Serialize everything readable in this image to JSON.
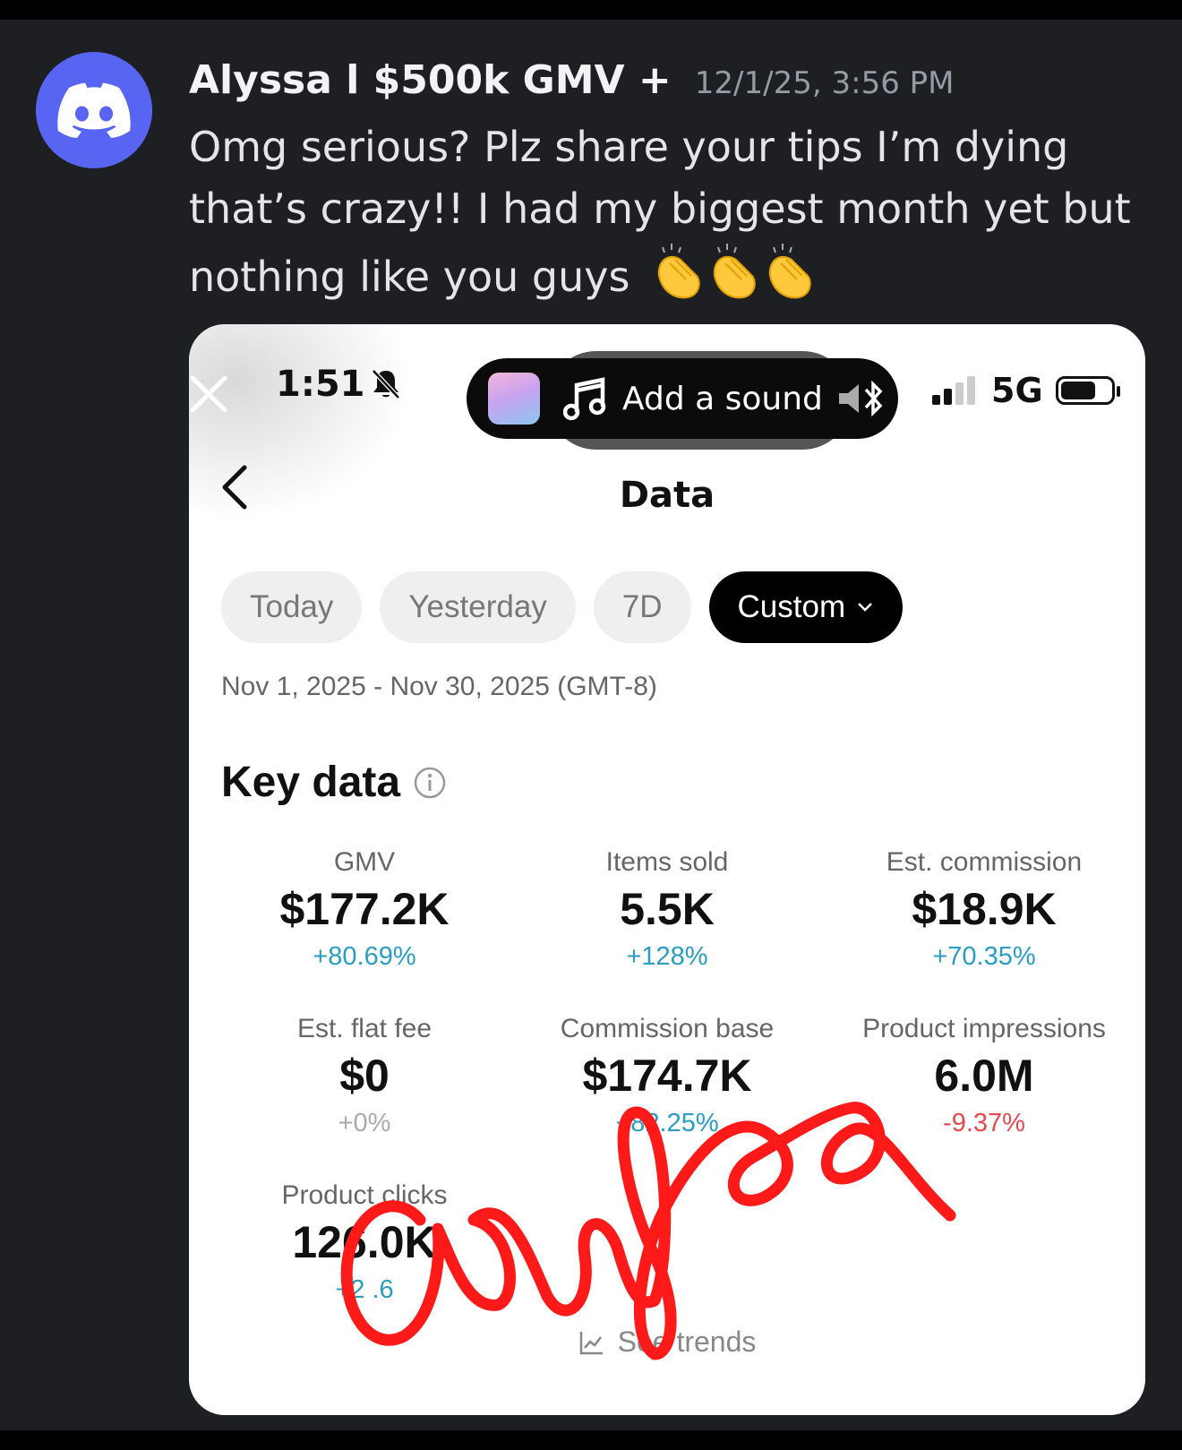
{
  "message": {
    "username": "Alyssa l $500k GMV +",
    "timestamp": "12/1/25, 3:56 PM",
    "text": "Omg serious? Plz share your tips I’m dying that’s crazy!! I had my biggest month yet but nothing like you guys",
    "emoji": "clapping-hands ×3"
  },
  "phone": {
    "status_time": "1:51",
    "network": "5G",
    "island_label": "Add a sound",
    "page_title": "Data",
    "tabs": [
      "Today",
      "Yesterday",
      "7D",
      "Custom"
    ],
    "active_tab": "Custom",
    "date_range": "Nov 1, 2025 - Nov 30, 2025 (GMT-8)",
    "section_title": "Key data",
    "metrics": [
      {
        "label": "GMV",
        "value": "$177.2K",
        "change": "+80.69%"
      },
      {
        "label": "Items sold",
        "value": "5.5K",
        "change": "+128%"
      },
      {
        "label": "Est. commission",
        "value": "$18.9K",
        "change": "+70.35%"
      },
      {
        "label": "Est. flat fee",
        "value": "$0",
        "change": "+0%"
      },
      {
        "label": "Commission base",
        "value": "$174.7K",
        "change": "+82.25%"
      },
      {
        "label": "Product impressions",
        "value": "6.0M",
        "change": "-9.37%"
      },
      {
        "label": "Product clicks",
        "value": "126.0K",
        "change": "+2 .6"
      }
    ],
    "see_trends": "See trends"
  },
  "colors": {
    "background": "#1e1f23",
    "discord_blurple": "#5865f2",
    "positive": "#2a9dc0",
    "negative": "#e5494f",
    "scribble": "#ff0000"
  }
}
